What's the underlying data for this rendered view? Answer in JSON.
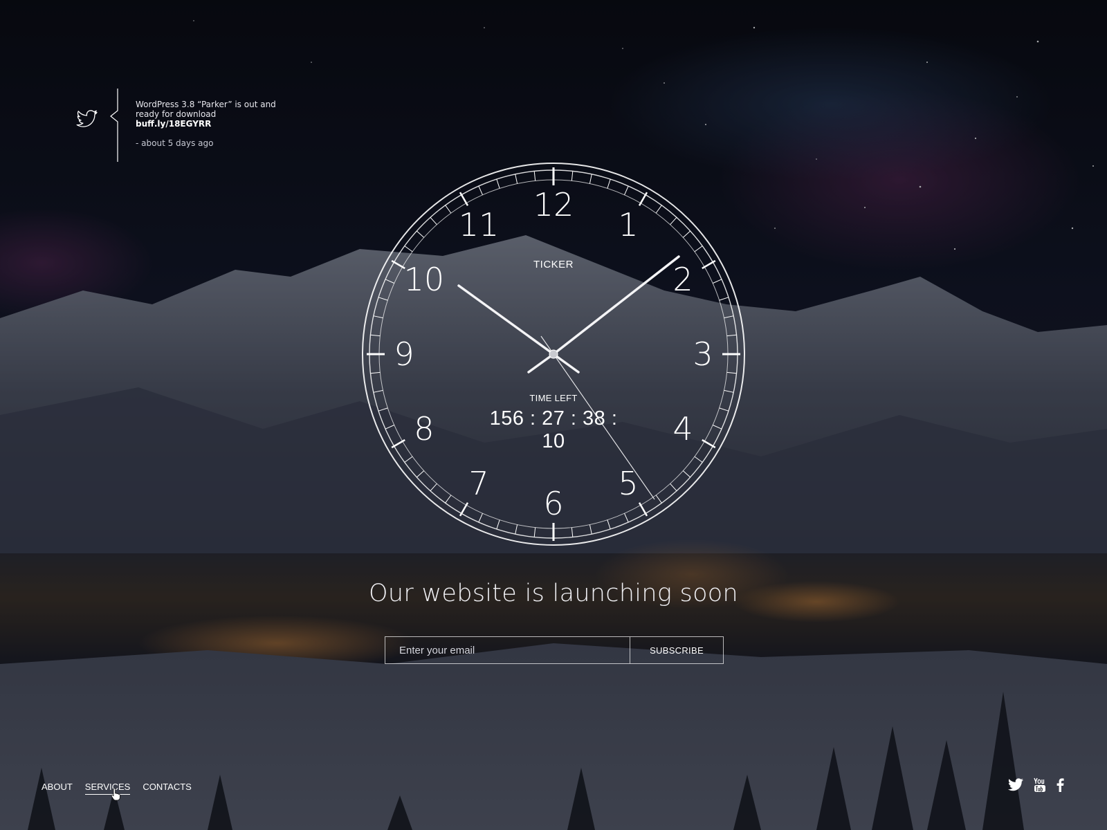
{
  "tweet": {
    "text": "WordPress 3.8 “Parker” is out and ready for download",
    "link": "buff.ly/18EGYRR",
    "time": "- about 5 days ago"
  },
  "clock": {
    "label": "TICKER",
    "time_left_label": "TIME LEFT",
    "countdown": "156 : 27 : 38 : 10",
    "numerals": [
      "12",
      "1",
      "2",
      "3",
      "4",
      "5",
      "6",
      "7",
      "8",
      "9",
      "10",
      "11"
    ]
  },
  "headline": "Our website is launching soon",
  "subscribe": {
    "placeholder": "Enter your email",
    "button_label": "SUBSCRIBE"
  },
  "nav": {
    "items": [
      {
        "label": "ABOUT"
      },
      {
        "label": "SERVICES"
      },
      {
        "label": "CONTACTS"
      }
    ],
    "active": "SERVICES"
  },
  "social": [
    "twitter-icon",
    "youtube-icon",
    "facebook-icon"
  ]
}
